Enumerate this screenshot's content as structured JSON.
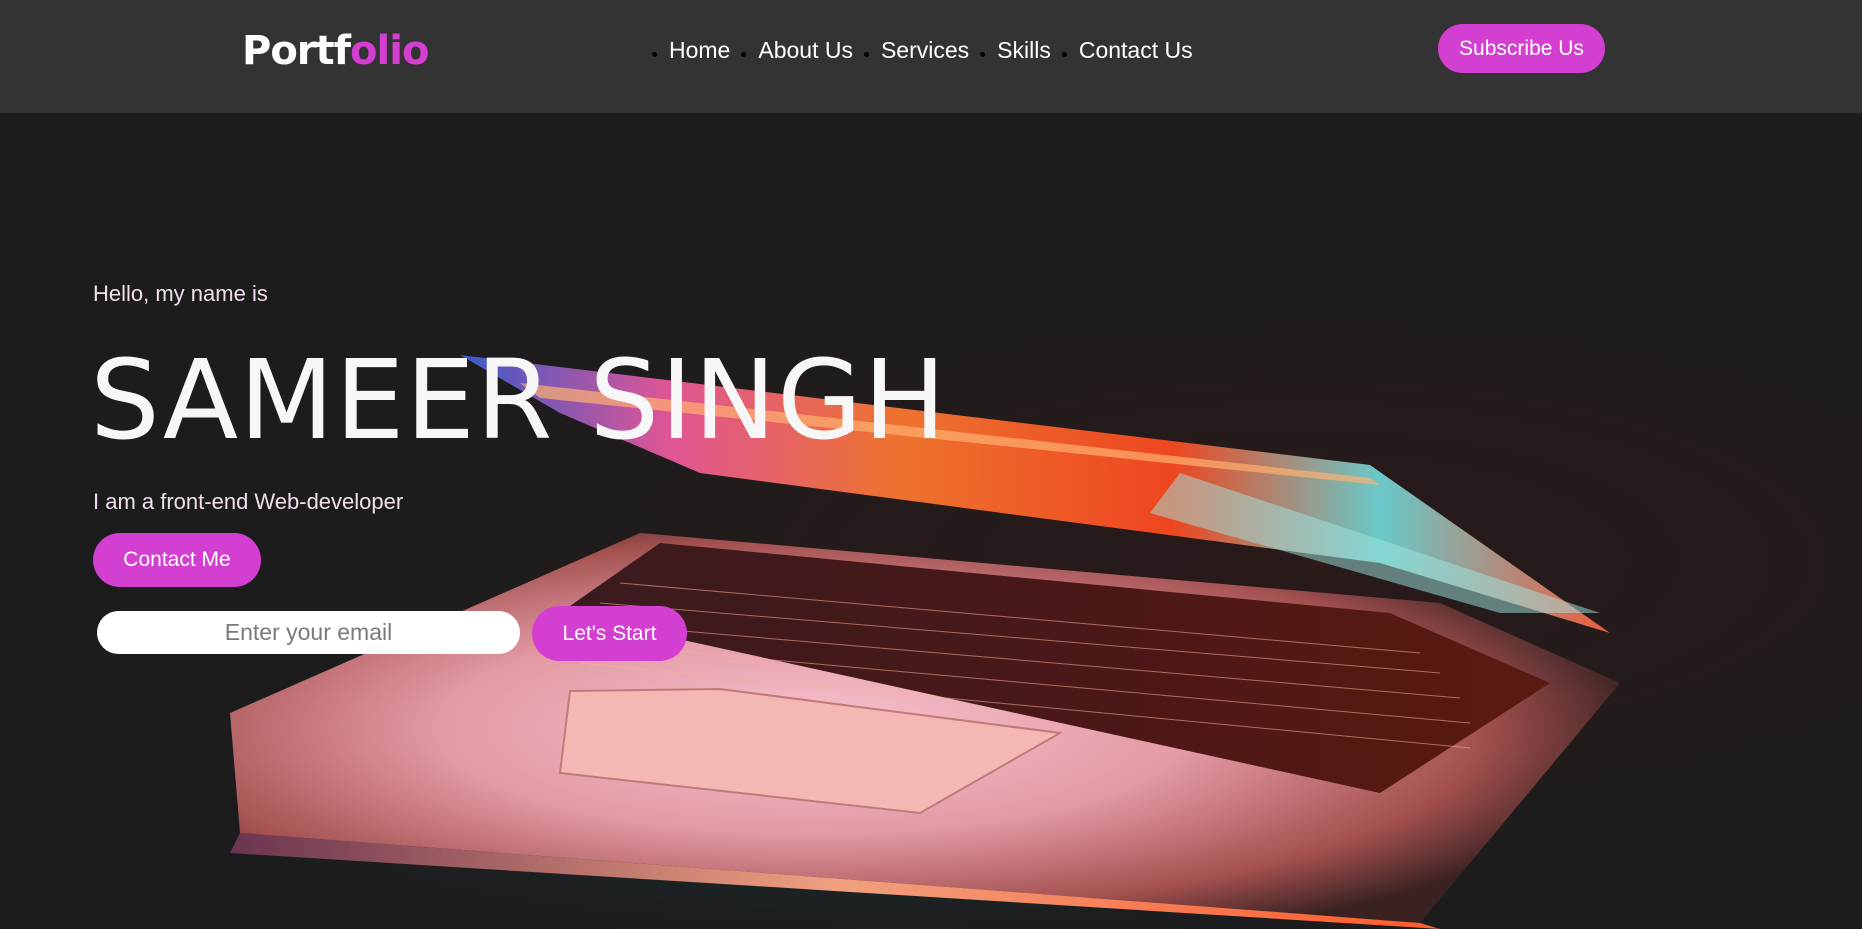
{
  "header": {
    "logo_part1": "Portf",
    "logo_part2": "olio",
    "nav": [
      "Home",
      "About Us",
      "Services",
      "Skills",
      "Contact Us"
    ],
    "subscribe_label": "Subscribe Us"
  },
  "hero": {
    "greeting": "Hello, my name is",
    "name": "SAMEER SINGH",
    "role": "I am a front-end Web-developer",
    "contact_label": "Contact Me",
    "email_placeholder": "Enter your email",
    "start_label": "Let's Start",
    "background_image": "laptop-backlit-keyboard"
  },
  "colors": {
    "accent": "#d33fd1",
    "navbar_bg": "#333333",
    "page_bg": "#1c1c1d"
  }
}
